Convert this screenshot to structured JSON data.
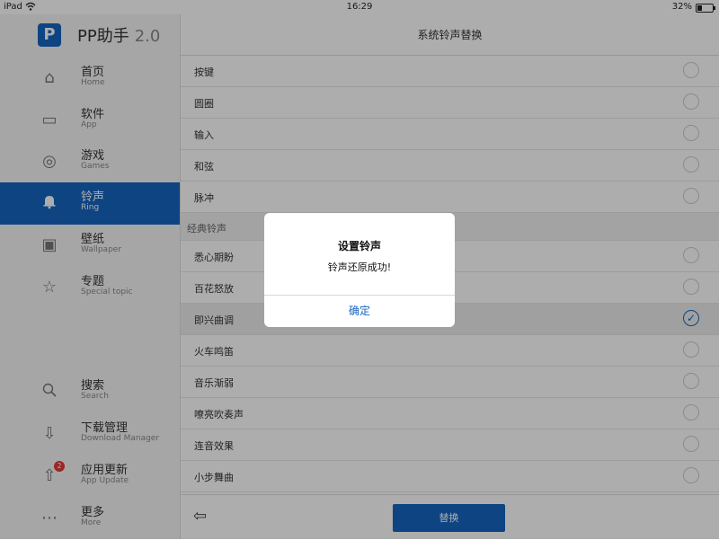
{
  "status": {
    "device": "iPad",
    "time": "16:29",
    "battery": "32%"
  },
  "app": {
    "name": "PP助手",
    "version": "2.0",
    "logo_letter": "P"
  },
  "sidebar": {
    "items": [
      {
        "label": "首页",
        "sub": "Home",
        "icon": "home-icon",
        "glyph": "⌂"
      },
      {
        "label": "软件",
        "sub": "App",
        "icon": "bag-icon",
        "glyph": "▭"
      },
      {
        "label": "游戏",
        "sub": "Games",
        "icon": "gamepad-icon",
        "glyph": "◎"
      },
      {
        "label": "铃声",
        "sub": "Ring",
        "icon": "bell-icon",
        "glyph": "🔔"
      },
      {
        "label": "壁纸",
        "sub": "Wallpaper",
        "icon": "image-icon",
        "glyph": "▣"
      },
      {
        "label": "专题",
        "sub": "Special topic",
        "icon": "star-icon",
        "glyph": "☆"
      },
      {
        "label": "搜索",
        "sub": "Search",
        "icon": "search-icon",
        "glyph": "⚲"
      },
      {
        "label": "下载管理",
        "sub": "Download Manager",
        "icon": "download-icon",
        "glyph": "⇩"
      },
      {
        "label": "应用更新",
        "sub": "App Update",
        "icon": "upload-icon",
        "glyph": "⇧",
        "badge": "2"
      },
      {
        "label": "更多",
        "sub": "More",
        "icon": "more-icon",
        "glyph": "⋯"
      }
    ]
  },
  "main": {
    "title": "系统铃声替换",
    "list": [
      {
        "name": "按键"
      },
      {
        "name": "圆圈"
      },
      {
        "name": "输入"
      },
      {
        "name": "和弦"
      },
      {
        "name": "脉冲"
      },
      {
        "section": "经典铃声"
      },
      {
        "name": "悉心期盼"
      },
      {
        "name": "百花怒放"
      },
      {
        "name": "即兴曲调",
        "selected": true
      },
      {
        "name": "火车鸣笛"
      },
      {
        "name": "音乐渐弱"
      },
      {
        "name": "嘹亮吹奏声"
      },
      {
        "name": "连音效果"
      },
      {
        "name": "小步舞曲"
      },
      {
        "name": ""
      }
    ],
    "back_glyph": "⇦",
    "replace_label": "替换"
  },
  "alert": {
    "title": "设置铃声",
    "message": "铃声还原成功!",
    "ok_label": "确定"
  },
  "colors": {
    "accent": "#1565c0",
    "badge": "#e53935"
  }
}
